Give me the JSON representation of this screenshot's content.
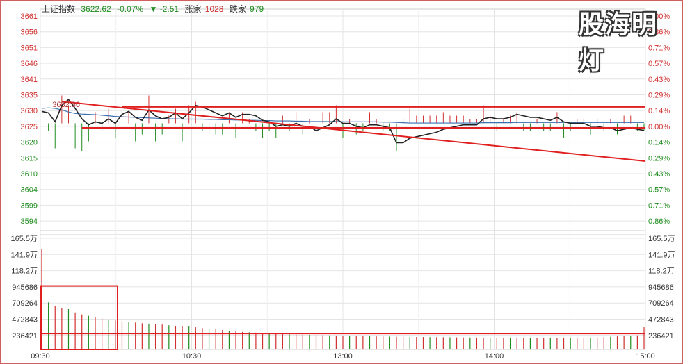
{
  "header": {
    "index_name": "上证指数",
    "price": "3622.62",
    "pct_change": "-0.07%",
    "arrow": "▼",
    "change": "-2.51",
    "up_label": "涨家",
    "up_count": "1028",
    "down_label": "跌家",
    "down_count": "979"
  },
  "watermark": "股海明灯",
  "colors": {
    "up": "#d03030",
    "down": "#1e8c1e",
    "price_line": "#222222",
    "avg_line": "#3a6fb0",
    "annotation": "#e02020",
    "grid": "#e4e4e4"
  },
  "chart_data": [
    {
      "type": "line",
      "title": "",
      "series": [
        {
          "values": [
            3629.0,
            3628.5,
            3625.5,
            3631.0,
            3633.0,
            3630.0,
            3626.5,
            3624.5,
            3625.5,
            3625.0,
            3626.5,
            3625.0,
            3628.0,
            3629.0,
            3627.0,
            3626.0,
            3629.5,
            3627.5,
            3626.5,
            3627.0,
            3628.5,
            3626.5,
            3628.5,
            3631.0,
            3630.5,
            3629.5,
            3628.5,
            3627.5,
            3628.5,
            3627.0,
            3628.0,
            3628.0,
            3627.5,
            3626.0,
            3625.5,
            3624.0,
            3624.5,
            3624.0,
            3625.0,
            3624.0,
            3624.0,
            3622.5,
            3623.5,
            3624.5,
            3626.5,
            3625.0,
            3625.0,
            3624.0,
            3623.5,
            3624.5,
            3624.5,
            3624.0,
            3623.5,
            3618.5,
            3618.5,
            3620.0,
            3620.5,
            3621.0,
            3621.5,
            3622.0,
            3623.0,
            3623.5,
            3624.0,
            3624.5,
            3624.5,
            3624.5,
            3626.5,
            3627.0,
            3626.5,
            3626.5,
            3627.0,
            3628.0,
            3627.5,
            3627.0,
            3627.0,
            3626.5,
            3626.0,
            3627.0,
            3625.5,
            3625.0,
            3625.0,
            3625.0,
            3624.0,
            3624.0,
            3623.5,
            3623.5,
            3622.5,
            3623.0,
            3623.5,
            3623.0,
            3622.6
          ]
        },
        {
          "values": [
            3630.0,
            3630.2,
            3630.0,
            3629.5,
            3628.8,
            3628.3,
            3628.1,
            3628.0,
            3627.9,
            3627.7,
            3627.5,
            3627.3,
            3627.2,
            3627.1,
            3627.0,
            3626.9,
            3626.8,
            3626.7,
            3626.6,
            3626.5,
            3626.5,
            3626.4,
            3626.4,
            3626.4,
            3626.4,
            3626.3,
            3626.3,
            3626.2,
            3626.2,
            3626.1,
            3626.1,
            3626.0,
            3626.0,
            3625.9,
            3625.9,
            3625.8,
            3625.8,
            3625.8,
            3625.7,
            3625.7,
            3625.6,
            3625.6,
            3625.6,
            3625.6,
            3625.6,
            3625.5,
            3625.5,
            3625.5,
            3625.5,
            3625.5,
            3625.5,
            3625.4,
            3625.4,
            3625.3,
            3625.2,
            3625.1,
            3625.1,
            3625.1,
            3625.1,
            3625.1,
            3625.1,
            3625.1,
            3625.1,
            3625.1,
            3625.1,
            3625.1,
            3625.2,
            3625.2,
            3625.2,
            3625.2,
            3625.2,
            3625.3,
            3625.3,
            3625.3,
            3625.3,
            3625.3,
            3625.3,
            3625.3,
            3625.3,
            3625.3,
            3625.3,
            3625.3,
            3625.3,
            3625.3,
            3625.3,
            3625.3,
            3625.3,
            3625.3,
            3625.3,
            3625.3,
            3625.3
          ]
        }
      ],
      "ylim": [
        3589,
        3661
      ],
      "y_ticks_left": [
        "3661",
        "3656",
        "3651",
        "3646",
        "3641",
        "3635",
        "3630",
        "3625",
        "3620",
        "3615",
        "3610",
        "3604",
        "3599",
        "3594"
      ],
      "y_ticks_right": [
        "1.00%",
        "0.86%",
        "0.71%",
        "0.57%",
        "0.43%",
        "0.29%",
        "0.14%",
        "0.00%",
        "0.14%",
        "0.29%",
        "0.43%",
        "0.57%",
        "0.71%",
        "0.86%"
      ],
      "x_ticks": [
        "09:30",
        "10:30",
        "13:00",
        "14:00",
        "15:00"
      ],
      "grid": true,
      "annotations": {
        "high_label": "3632.36",
        "resistance": 3630.5,
        "support": 3623.5,
        "trendline_start": 3632.3,
        "trendline_end": 3612.3
      }
    },
    {
      "type": "bar",
      "title": "",
      "y_ticks": [
        "165.5万",
        "141.9万",
        "118.2万",
        "945686",
        "709264",
        "472843",
        "236421"
      ],
      "ylim": [
        0,
        1655000
      ],
      "values": [
        1500000,
        700000,
        650000,
        620000,
        600000,
        550000,
        520000,
        500000,
        480000,
        460000,
        440000,
        430000,
        420000,
        410000,
        400000,
        390000,
        385000,
        380000,
        370000,
        360000,
        350000,
        345000,
        340000,
        330000,
        320000,
        310000,
        300000,
        290000,
        280000,
        270000,
        260000,
        255000,
        250000,
        245000,
        240000,
        235000,
        230000,
        225000,
        222000,
        220000,
        218000,
        215000,
        212000,
        210000,
        208000,
        205000,
        203000,
        200000,
        198000,
        196000,
        195000,
        194000,
        192000,
        190000,
        188000,
        187000,
        186000,
        185000,
        184000,
        183000,
        182000,
        181000,
        180000,
        179000,
        178000,
        177000,
        176000,
        175000,
        174000,
        173000,
        172000,
        171000,
        170000,
        170000,
        170000,
        170000,
        170000,
        170000,
        170000,
        170000,
        170000,
        170000,
        175000,
        180000,
        185000,
        190000,
        195000,
        200000,
        205000,
        210000,
        330000
      ],
      "annotations": {
        "baseline_volume": 236421,
        "box_top_volume": 945686
      }
    }
  ]
}
